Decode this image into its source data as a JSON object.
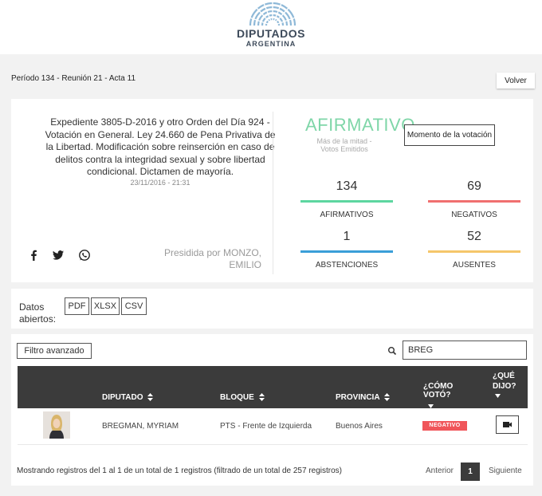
{
  "header": {
    "title": "DIPUTADOS",
    "subtitle": "ARGENTINA"
  },
  "session": {
    "period_line": "Período 134 - Reunión 21 - Acta 11",
    "back_label": "Volver"
  },
  "vote": {
    "title": "Expediente 3805-D-2016 y otro Orden del Día 924 - Votación en General. Ley 24.660 de Pena Privativa de la Libertad. Modificación sobre reinserción en caso de delitos contra la integridad sexual y sobre libertad condicional. Dictamen de mayoría.",
    "date": "23/11/2016 - 21:31",
    "result": "AFIRMATIVO",
    "majority": "Más de la mitad - Votos Emitidos",
    "moment_button": "Momento de la votación",
    "presided_by": "Presidida por MONZO, EMILIO",
    "social_icons": [
      "facebook-icon",
      "twitter-icon",
      "whatsapp-icon"
    ],
    "stats": [
      {
        "value": "134",
        "label": "AFIRMATIVOS",
        "color": "#5dd6a0"
      },
      {
        "value": "69",
        "label": "NEGATIVOS",
        "color": "#f07070"
      },
      {
        "value": "1",
        "label": "ABSTENCIONES",
        "color": "#3a9ed8"
      },
      {
        "value": "52",
        "label": "AUSENTES",
        "color": "#f5c66a"
      }
    ]
  },
  "open_data": {
    "label": "Datos abiertos:",
    "buttons": [
      "PDF",
      "XLSX",
      "CSV"
    ]
  },
  "table": {
    "advanced_filter": "Filtro avanzado",
    "search_value": "BREG",
    "columns": {
      "diputado": "DIPUTADO",
      "bloque": "BLOQUE",
      "provincia": "PROVINCIA",
      "como_voto": "¿CÓMO VOTÓ?",
      "que_dijo": "¿QUÉ DIJO?"
    },
    "rows": [
      {
        "diputado": "BREGMAN, MYRIAM",
        "bloque": "PTS - Frente de Izquierda",
        "provincia": "Buenos Aires",
        "voto": "NEGATIVO"
      }
    ],
    "info": "Mostrando registros del 1 al 1 de un total de 1 registros (filtrado de un total de 257 registros)",
    "pager": {
      "prev": "Anterior",
      "current": "1",
      "next": "Siguiente"
    }
  },
  "colors": {
    "afirmativo": "#7fd6a8",
    "negativo_badge": "#f0555a",
    "table_header": "#3b3b3b"
  }
}
